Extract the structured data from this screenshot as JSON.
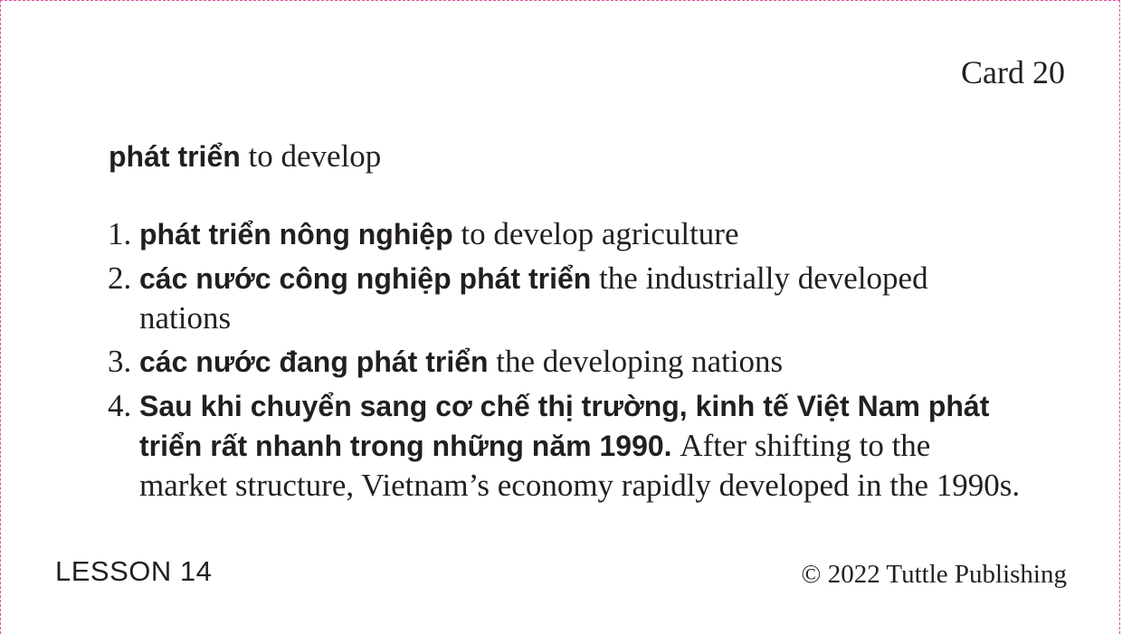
{
  "card": {
    "number_label": "Card 20",
    "headword": {
      "vietnamese": "phát triển",
      "english": "to develop"
    },
    "examples": [
      {
        "number": "1.",
        "vietnamese": "phát triển nông nghiệp",
        "english": "to develop agriculture"
      },
      {
        "number": "2.",
        "vietnamese": "các nước công nghiệp phát triển",
        "english": "the industrially developed nations"
      },
      {
        "number": "3.",
        "vietnamese": "các nước đang phát triển",
        "english": "the developing nations"
      },
      {
        "number": "4.",
        "vietnamese": "Sau khi chuyển sang cơ chế thị trường, kinh tế Việt Nam phát triển rất nhanh trong những năm 1990.",
        "english": "After shifting to the market structure, Vietnam’s economy rapidly developed in the 1990s."
      }
    ],
    "lesson_label": "LESSON 14",
    "copyright": "© 2022 Tuttle Publishing"
  },
  "colors": {
    "text": "#231f20",
    "cut_border": "#e0529c"
  }
}
